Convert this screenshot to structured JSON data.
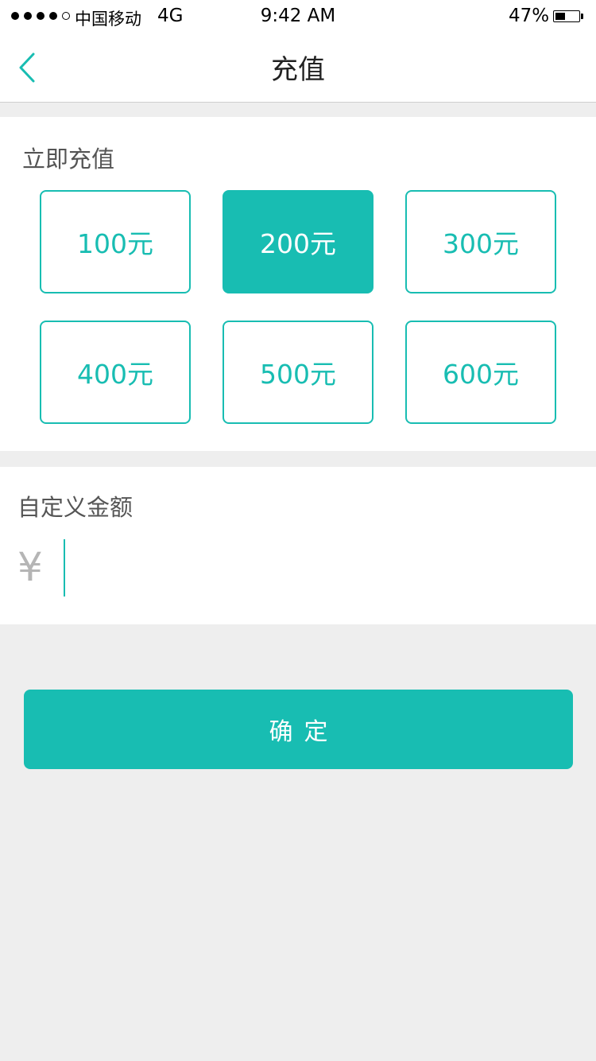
{
  "status_bar": {
    "carrier": "中国移动",
    "network": "4G",
    "time": "9:42 AM",
    "battery_percent": "47%",
    "battery_level": 0.47
  },
  "nav": {
    "back_icon": "chevron-left-icon",
    "title": "充值"
  },
  "recharge": {
    "heading": "立即充值",
    "options": [
      {
        "label": "100元",
        "selected": false
      },
      {
        "label": "200元",
        "selected": true
      },
      {
        "label": "300元",
        "selected": false
      },
      {
        "label": "400元",
        "selected": false
      },
      {
        "label": "500元",
        "selected": false
      },
      {
        "label": "600元",
        "selected": false
      }
    ]
  },
  "custom": {
    "heading": "自定义金额",
    "currency_symbol": "¥",
    "value": "",
    "placeholder": ""
  },
  "confirm": {
    "label": "确定"
  },
  "colors": {
    "accent": "#18bdb2",
    "background": "#eeeeee",
    "card": "#ffffff"
  }
}
